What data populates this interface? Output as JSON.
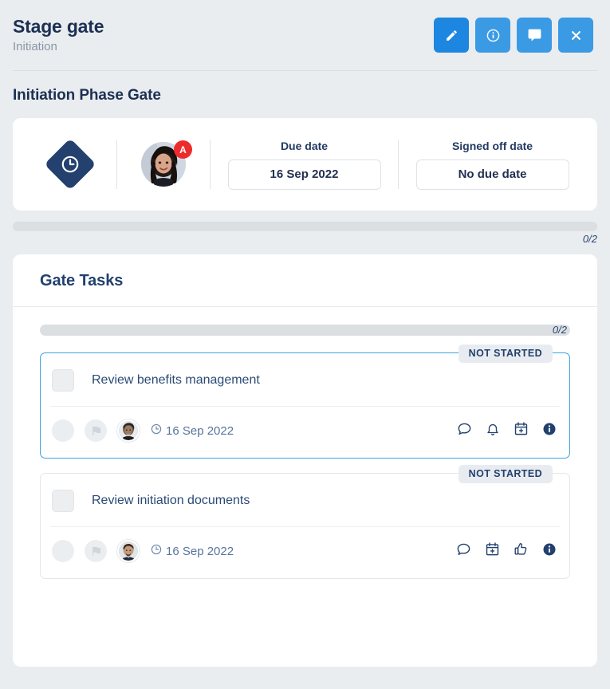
{
  "header": {
    "title": "Stage gate",
    "subtitle": "Initiation",
    "actions": [
      {
        "name": "edit-button",
        "icon": "pencil-icon",
        "style": "primary"
      },
      {
        "name": "info-button",
        "icon": "info-icon",
        "style": "default"
      },
      {
        "name": "comment-button",
        "icon": "comment-icon",
        "style": "default"
      },
      {
        "name": "close-button",
        "icon": "close-icon",
        "style": "default"
      }
    ]
  },
  "section": {
    "heading": "Initiation Phase Gate"
  },
  "gate_info": {
    "icon": "gate-diamond-clock-icon",
    "assignee": {
      "avatar": "assignee-avatar",
      "badge_label": "A",
      "badge_color": "#ee2b2b"
    },
    "due_date": {
      "label": "Due date",
      "value": "16 Sep 2022"
    },
    "signed_off_date": {
      "label": "Signed off date",
      "value": "No due date"
    }
  },
  "gate_progress": {
    "count_label": "0/2",
    "completed": 0,
    "total": 2,
    "percent": 0
  },
  "tasks_panel": {
    "title": "Gate Tasks",
    "progress": {
      "count_label": "0/2",
      "completed": 0,
      "total": 2,
      "percent": 0
    },
    "tasks": [
      {
        "status": "NOT STARTED",
        "name": "Review benefits management",
        "date": "16 Sep 2022",
        "checked": false,
        "highlighted": true,
        "actions": [
          "comment-icon",
          "bell-icon",
          "calendar-plus-icon",
          "info-icon"
        ]
      },
      {
        "status": "NOT STARTED",
        "name": "Review initiation documents",
        "date": "16 Sep 2022",
        "checked": false,
        "highlighted": false,
        "actions": [
          "comment-icon",
          "calendar-plus-icon",
          "thumbs-up-icon",
          "info-icon"
        ]
      }
    ]
  },
  "colors": {
    "page_background": "#e9edef",
    "primary_blue": "#1d86e0",
    "action_blue": "#3b9ae4",
    "navy": "#1d3054",
    "highlight_border": "#3ba3dd",
    "badge_red": "#ee2b2b",
    "status_badge_bg": "#e8ecf1"
  }
}
